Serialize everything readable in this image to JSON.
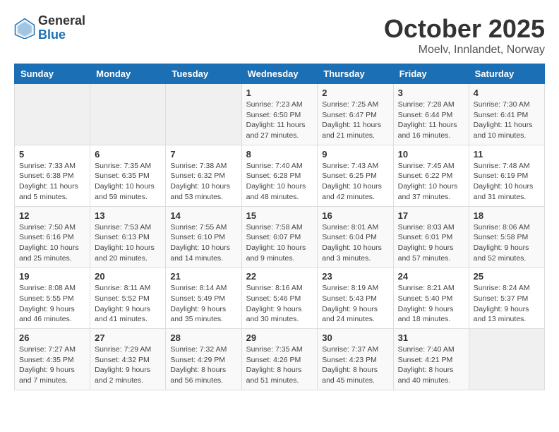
{
  "logo": {
    "general": "General",
    "blue": "Blue"
  },
  "title": "October 2025",
  "location": "Moelv, Innlandet, Norway",
  "weekdays": [
    "Sunday",
    "Monday",
    "Tuesday",
    "Wednesday",
    "Thursday",
    "Friday",
    "Saturday"
  ],
  "weeks": [
    [
      {
        "day": "",
        "info": ""
      },
      {
        "day": "",
        "info": ""
      },
      {
        "day": "",
        "info": ""
      },
      {
        "day": "1",
        "info": "Sunrise: 7:23 AM\nSunset: 6:50 PM\nDaylight: 11 hours and 27 minutes."
      },
      {
        "day": "2",
        "info": "Sunrise: 7:25 AM\nSunset: 6:47 PM\nDaylight: 11 hours and 21 minutes."
      },
      {
        "day": "3",
        "info": "Sunrise: 7:28 AM\nSunset: 6:44 PM\nDaylight: 11 hours and 16 minutes."
      },
      {
        "day": "4",
        "info": "Sunrise: 7:30 AM\nSunset: 6:41 PM\nDaylight: 11 hours and 10 minutes."
      }
    ],
    [
      {
        "day": "5",
        "info": "Sunrise: 7:33 AM\nSunset: 6:38 PM\nDaylight: 11 hours and 5 minutes."
      },
      {
        "day": "6",
        "info": "Sunrise: 7:35 AM\nSunset: 6:35 PM\nDaylight: 10 hours and 59 minutes."
      },
      {
        "day": "7",
        "info": "Sunrise: 7:38 AM\nSunset: 6:32 PM\nDaylight: 10 hours and 53 minutes."
      },
      {
        "day": "8",
        "info": "Sunrise: 7:40 AM\nSunset: 6:28 PM\nDaylight: 10 hours and 48 minutes."
      },
      {
        "day": "9",
        "info": "Sunrise: 7:43 AM\nSunset: 6:25 PM\nDaylight: 10 hours and 42 minutes."
      },
      {
        "day": "10",
        "info": "Sunrise: 7:45 AM\nSunset: 6:22 PM\nDaylight: 10 hours and 37 minutes."
      },
      {
        "day": "11",
        "info": "Sunrise: 7:48 AM\nSunset: 6:19 PM\nDaylight: 10 hours and 31 minutes."
      }
    ],
    [
      {
        "day": "12",
        "info": "Sunrise: 7:50 AM\nSunset: 6:16 PM\nDaylight: 10 hours and 25 minutes."
      },
      {
        "day": "13",
        "info": "Sunrise: 7:53 AM\nSunset: 6:13 PM\nDaylight: 10 hours and 20 minutes."
      },
      {
        "day": "14",
        "info": "Sunrise: 7:55 AM\nSunset: 6:10 PM\nDaylight: 10 hours and 14 minutes."
      },
      {
        "day": "15",
        "info": "Sunrise: 7:58 AM\nSunset: 6:07 PM\nDaylight: 10 hours and 9 minutes."
      },
      {
        "day": "16",
        "info": "Sunrise: 8:01 AM\nSunset: 6:04 PM\nDaylight: 10 hours and 3 minutes."
      },
      {
        "day": "17",
        "info": "Sunrise: 8:03 AM\nSunset: 6:01 PM\nDaylight: 9 hours and 57 minutes."
      },
      {
        "day": "18",
        "info": "Sunrise: 8:06 AM\nSunset: 5:58 PM\nDaylight: 9 hours and 52 minutes."
      }
    ],
    [
      {
        "day": "19",
        "info": "Sunrise: 8:08 AM\nSunset: 5:55 PM\nDaylight: 9 hours and 46 minutes."
      },
      {
        "day": "20",
        "info": "Sunrise: 8:11 AM\nSunset: 5:52 PM\nDaylight: 9 hours and 41 minutes."
      },
      {
        "day": "21",
        "info": "Sunrise: 8:14 AM\nSunset: 5:49 PM\nDaylight: 9 hours and 35 minutes."
      },
      {
        "day": "22",
        "info": "Sunrise: 8:16 AM\nSunset: 5:46 PM\nDaylight: 9 hours and 30 minutes."
      },
      {
        "day": "23",
        "info": "Sunrise: 8:19 AM\nSunset: 5:43 PM\nDaylight: 9 hours and 24 minutes."
      },
      {
        "day": "24",
        "info": "Sunrise: 8:21 AM\nSunset: 5:40 PM\nDaylight: 9 hours and 18 minutes."
      },
      {
        "day": "25",
        "info": "Sunrise: 8:24 AM\nSunset: 5:37 PM\nDaylight: 9 hours and 13 minutes."
      }
    ],
    [
      {
        "day": "26",
        "info": "Sunrise: 7:27 AM\nSunset: 4:35 PM\nDaylight: 9 hours and 7 minutes."
      },
      {
        "day": "27",
        "info": "Sunrise: 7:29 AM\nSunset: 4:32 PM\nDaylight: 9 hours and 2 minutes."
      },
      {
        "day": "28",
        "info": "Sunrise: 7:32 AM\nSunset: 4:29 PM\nDaylight: 8 hours and 56 minutes."
      },
      {
        "day": "29",
        "info": "Sunrise: 7:35 AM\nSunset: 4:26 PM\nDaylight: 8 hours and 51 minutes."
      },
      {
        "day": "30",
        "info": "Sunrise: 7:37 AM\nSunset: 4:23 PM\nDaylight: 8 hours and 45 minutes."
      },
      {
        "day": "31",
        "info": "Sunrise: 7:40 AM\nSunset: 4:21 PM\nDaylight: 8 hours and 40 minutes."
      },
      {
        "day": "",
        "info": ""
      }
    ]
  ]
}
